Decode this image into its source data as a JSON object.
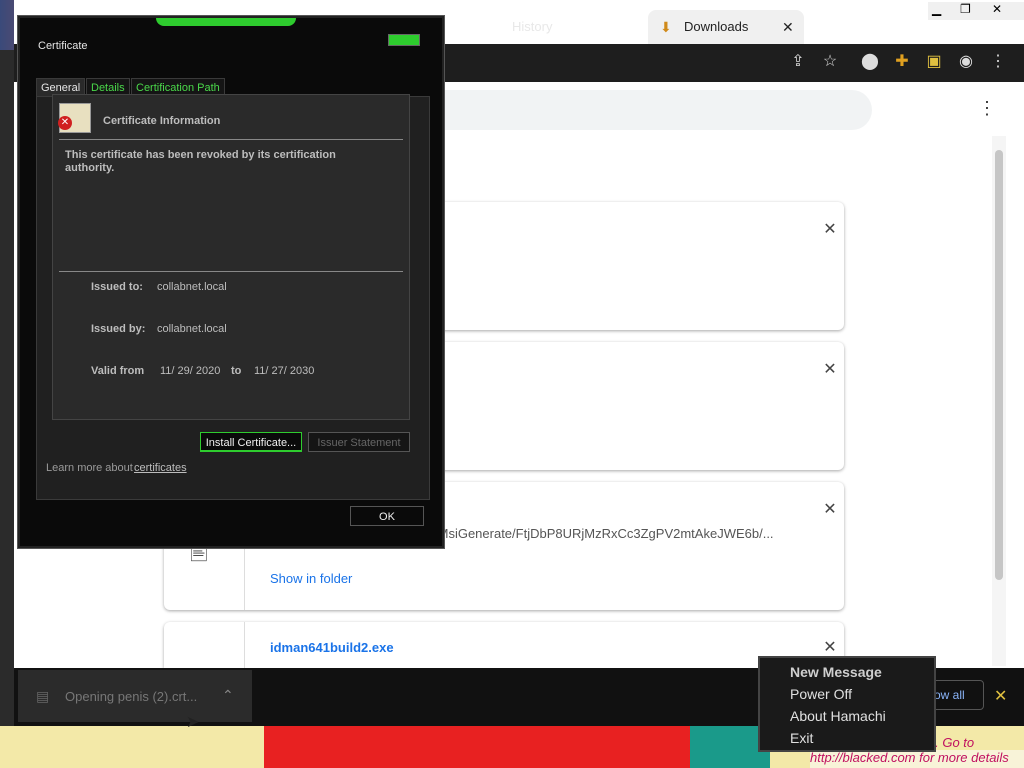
{
  "browser": {
    "tabs": [
      "History",
      "Downloads"
    ],
    "active_tab_label": "Downloads",
    "add_tab": "+"
  },
  "downloads": {
    "cards": [
      {
        "path": "/MsiGenerate/FtjDbP8URjMzRxCc3ZgPV2mtAkeJWE6b/...",
        "action": "Show in folder"
      },
      {
        "filename": "idman641build2.exe"
      }
    ]
  },
  "shelf": {
    "item_label": "Opening penis (2).crt...",
    "show_all": "Show all"
  },
  "dialog": {
    "title": "Certificate",
    "tabs": [
      "General",
      "Details",
      "Certification Path"
    ],
    "info_heading": "Certificate Information",
    "message": "This certificate has been revoked by its certification authority.",
    "issued_to_label": "Issued to:",
    "issued_to_value": "collabnet.local",
    "issued_by_label": "Issued by:",
    "issued_by_value": "collabnet.local",
    "valid_from_label": "Valid from",
    "valid_from_value": "11/ 29/ 2020",
    "valid_to_label": "to",
    "valid_to_value": "11/ 27/ 2030",
    "install_button": "Install Certificate...",
    "issuer_button": "Issuer Statement",
    "learn_more_prefix": "Learn more about",
    "learn_more_link": "certificates",
    "ok_button": "OK"
  },
  "context_menu": {
    "items": [
      "New Message",
      "Power Off",
      "About Hamachi",
      "Exit"
    ]
  },
  "wallpaper": {
    "link_text": "http://blacked.com for more details",
    "partial_text": "el. Go to"
  }
}
